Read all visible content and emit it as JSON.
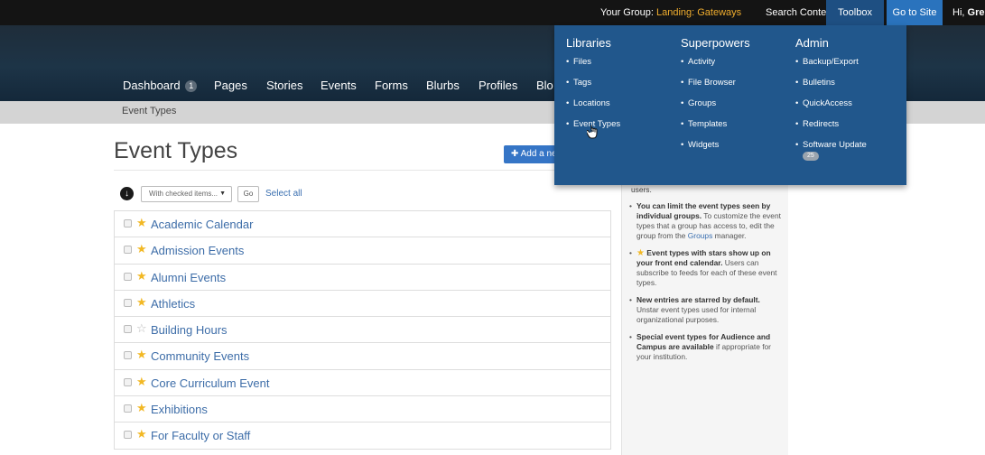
{
  "topbar": {
    "group_label": "Your Group:",
    "group_name": "Landing: Gateways",
    "search": "Search Content",
    "toolbox": "Toolbox",
    "go_to_site": "Go to Site",
    "greeting_prefix": "Hi,",
    "greeting_name": "Gre"
  },
  "nav": {
    "items": [
      "Dashboard",
      "Pages",
      "Stories",
      "Events",
      "Forms",
      "Blurbs",
      "Profiles",
      "Blo"
    ],
    "dashboard_badge": "1"
  },
  "breadcrumb": "Event Types",
  "page": {
    "title": "Event Types",
    "add_button": "Add a ne"
  },
  "bulk": {
    "select_placeholder": "With checked items...",
    "go": "Go",
    "select_all": "Select all"
  },
  "event_types": [
    {
      "label": "Academic Calendar",
      "starred": true
    },
    {
      "label": "Admission Events",
      "starred": true
    },
    {
      "label": "Alumni Events",
      "starred": true
    },
    {
      "label": "Athletics",
      "starred": true
    },
    {
      "label": "Building Hours",
      "starred": false
    },
    {
      "label": "Community Events",
      "starred": true
    },
    {
      "label": "Core Curriculum Event",
      "starred": true
    },
    {
      "label": "Exhibitions",
      "starred": true
    },
    {
      "label": "For Faculty or Staff",
      "starred": true
    }
  ],
  "help": {
    "lead": "users.",
    "tip1_bold": "You can limit the event types seen by individual groups.",
    "tip1_text": " To customize the event types that a group has access to, edit the group from the ",
    "tip1_link": "Groups",
    "tip1_end": " manager.",
    "tip2_bold": "Event types with stars show up on your front end calendar.",
    "tip2_text": " Users can subscribe to feeds for each of these event types.",
    "tip3_bold": "New entries are starred by default.",
    "tip3_text": " Unstar event types used for internal organizational purposes.",
    "tip4_bold": "Special event types for Audience and Campus are available",
    "tip4_text": " if appropriate for your institution."
  },
  "toolbox_menu": {
    "libraries": {
      "heading": "Libraries",
      "items": [
        "Files",
        "Tags",
        "Locations",
        "Event Types"
      ]
    },
    "superpowers": {
      "heading": "Superpowers",
      "items": [
        "Activity",
        "File Browser",
        "Groups",
        "Templates",
        "Widgets"
      ]
    },
    "admin": {
      "heading": "Admin",
      "items": [
        "Backup/Export",
        "Bulletins",
        "QuickAccess",
        "Redirects",
        "Software Update"
      ],
      "software_update_count": "25"
    }
  },
  "colors": {
    "dropdown_bg": "#21578c",
    "accent_button": "#3575c6",
    "star": "#f2b824",
    "link": "#3d6da8"
  }
}
